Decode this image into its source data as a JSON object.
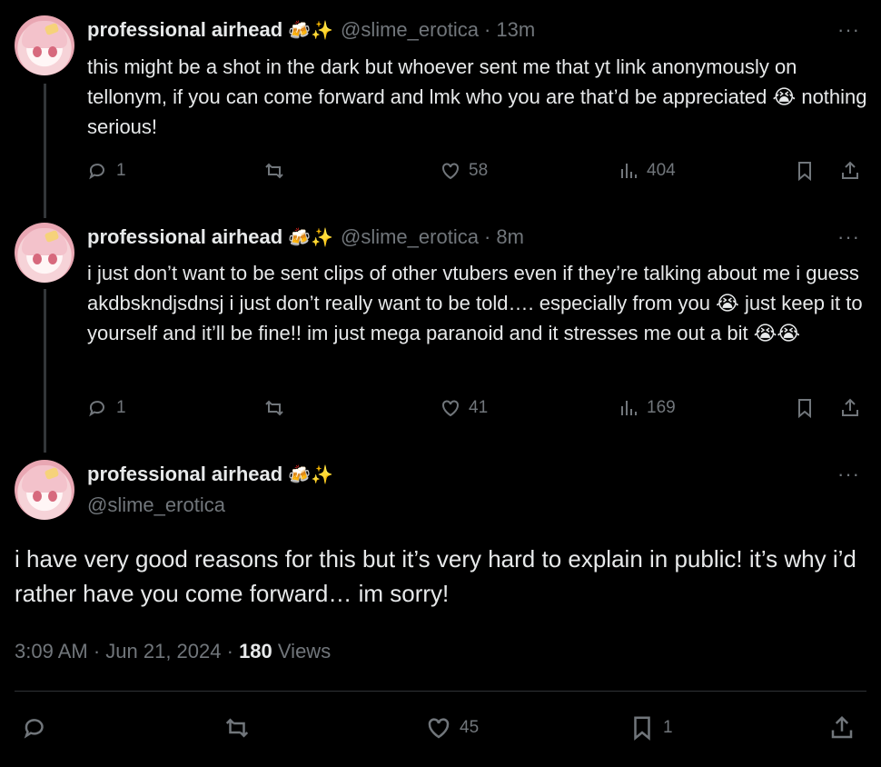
{
  "tweets": [
    {
      "name": "professional airhead",
      "emojis": "🍻✨",
      "handle": "@slime_erotica",
      "time": "· 13m",
      "text": "this might be a shot in the dark but whoever sent me that yt link anonymously on tellonym, if you can come forward and lmk who you are that’d be appreciated 😭 nothing serious!",
      "replies": "1",
      "likes": "58",
      "views": "404"
    },
    {
      "name": "professional airhead",
      "emojis": "🍻✨",
      "handle": "@slime_erotica",
      "time": "· 8m",
      "text": "i just don’t want to be sent clips of other vtubers even if they’re talking about me i guess akdbskndjsdnsj i just don’t really want to be told…. especially from you 😭 just keep it to yourself and it’ll be fine!! im just mega paranoid and it stresses me out a bit 😭😭",
      "replies": "1",
      "likes": "41",
      "views": "169"
    }
  ],
  "main_tweet": {
    "name": "professional airhead",
    "emojis": "🍻✨",
    "handle": "@slime_erotica",
    "text": "i have very good reasons for this but it’s very hard to explain in public! it’s why i’d rather have you come forward… im sorry!",
    "timestamp": "3:09 AM · Jun 21, 2024 ·",
    "views_count": "180",
    "views_label": "Views",
    "likes": "45",
    "bookmarks": "1"
  },
  "more_glyph": "···",
  "colors": {
    "background": "#000000",
    "text": "#e7e9ea",
    "muted": "#71767b",
    "divider": "#2f3336"
  },
  "icons": [
    "reply-icon",
    "retweet-icon",
    "like-icon",
    "views-icon",
    "bookmark-icon",
    "share-icon",
    "more-icon"
  ]
}
